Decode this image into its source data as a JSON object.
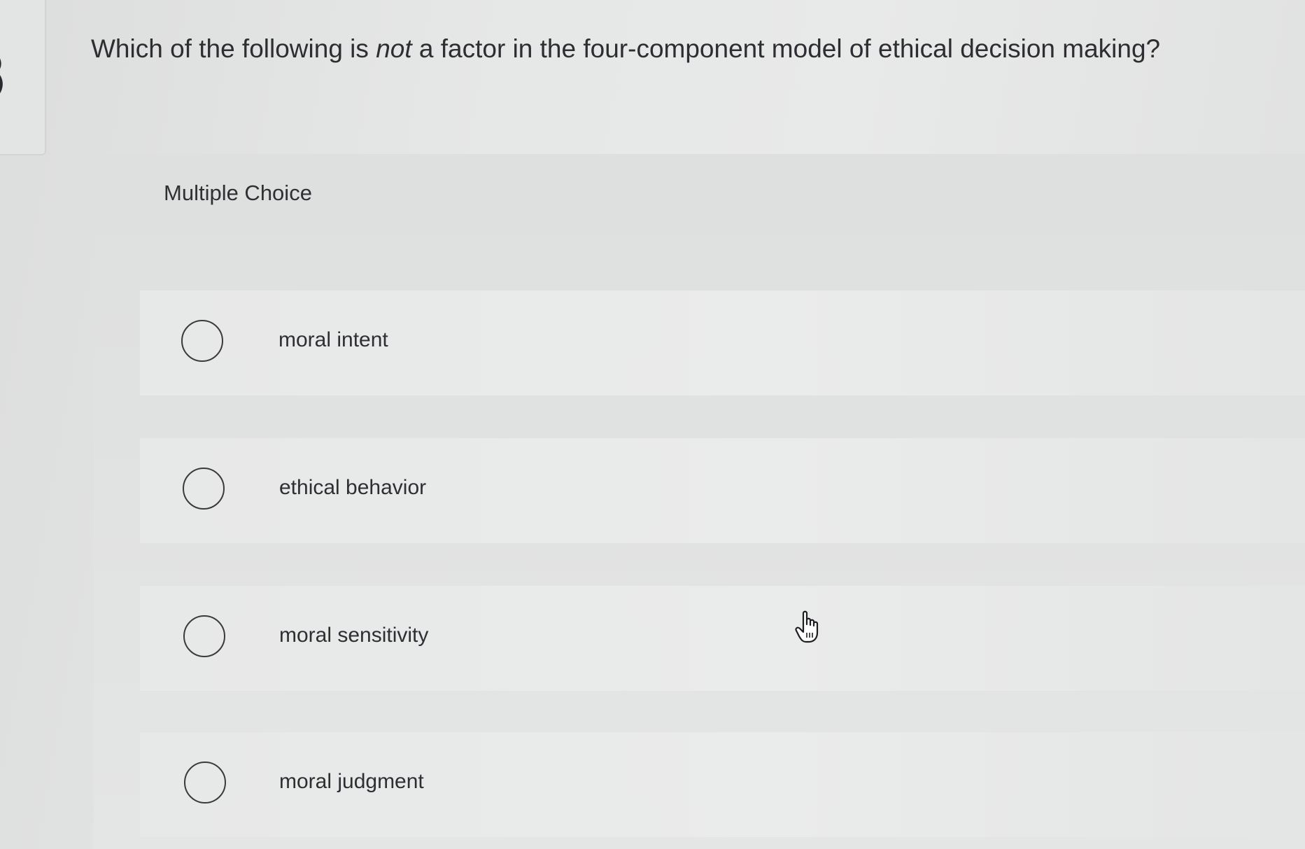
{
  "question": {
    "prefix": "Which of the following is ",
    "emphasis": "not",
    "suffix": " a factor in the four-component model of ethical decision making?"
  },
  "panel": {
    "heading": "Multiple Choice"
  },
  "choices": [
    {
      "label": "moral intent",
      "selected": false
    },
    {
      "label": "ethical behavior",
      "selected": false
    },
    {
      "label": "moral sensitivity",
      "selected": false
    },
    {
      "label": "moral judgment",
      "selected": false
    }
  ],
  "icons": {
    "cursor": "hand-pointer-icon",
    "radio": "radio-circle-icon"
  },
  "colors": {
    "text": "#2f2f33",
    "radio_border": "#3a3a3e",
    "background": "#e6e7e7"
  }
}
